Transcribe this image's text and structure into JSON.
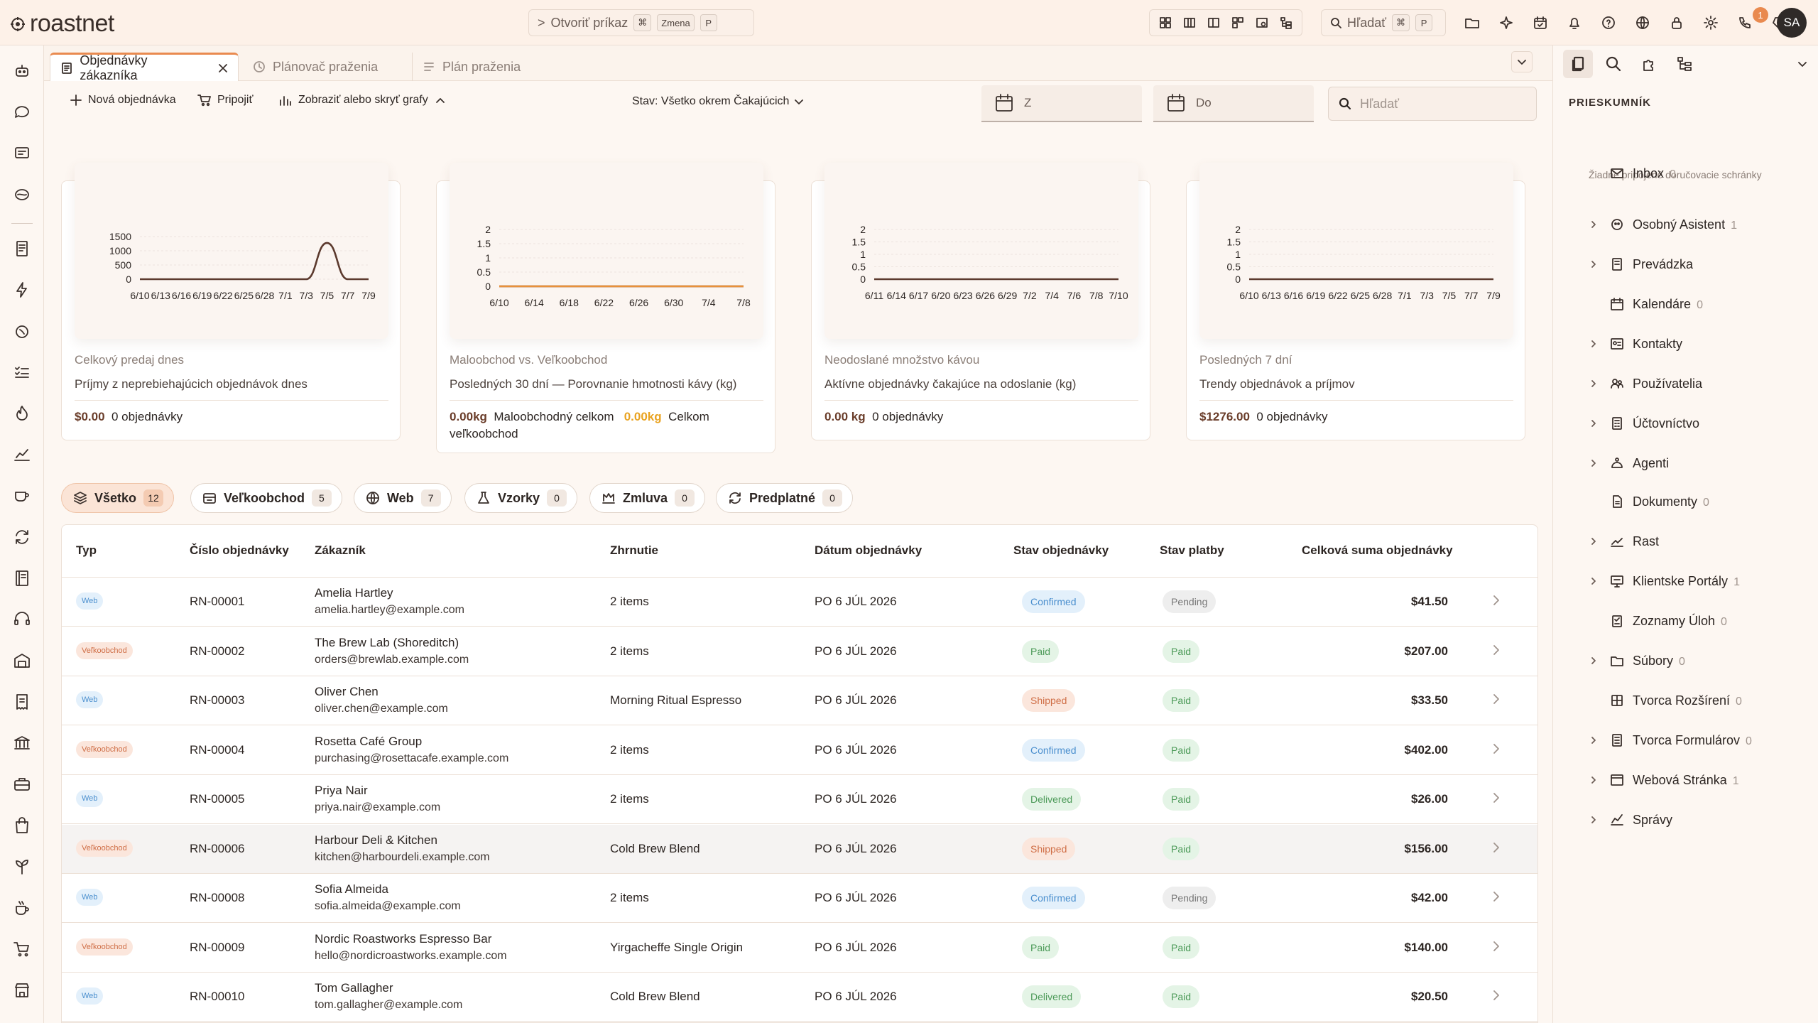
{
  "app": {
    "name": "roastnet"
  },
  "command": {
    "label": "Otvoriť príkaz",
    "k1": "⌘",
    "k2": "Zmena",
    "k3": "P"
  },
  "top_search": {
    "label": "Hľadať",
    "k1": "⌘",
    "k2": "P"
  },
  "notifications": {
    "count": "1"
  },
  "user": {
    "initials": "SA"
  },
  "tabs": [
    {
      "label": "Objednávky zákazníka"
    },
    {
      "label": "Plánovač praženia"
    },
    {
      "label": "Plán praženia"
    }
  ],
  "toolbar": {
    "new_order": "Nová objednávka",
    "connect": "Pripojiť",
    "toggle_charts": "Zobraziť alebo skryť grafy",
    "status_filter": "Stav: Všetko okrem Čakajúcich",
    "date_from": "Z",
    "date_to": "Do",
    "search_placeholder": "Hľadať"
  },
  "cards": [
    {
      "label": "Celkový predaj dnes",
      "desc": "Príjmy z neprebiehajúcich objednávok dnes",
      "stat1": "$0.00",
      "stat1_text": "0 objednávky",
      "stat2": "",
      "stat2_text": ""
    },
    {
      "label": "Maloobchod vs. Veľkoobchod",
      "desc": "Posledných 30 dní — Porovnanie hmotnosti kávy (kg)",
      "stat1": "0.00kg",
      "stat1_text": "Maloobchodný celkom",
      "stat2": "0.00kg",
      "stat2_text": "Celkom veľkoobchod"
    },
    {
      "label": "Neodoslané množstvo kávou",
      "desc": "Aktívne objednávky čakajúce na odoslanie (kg)",
      "stat1": "0.00 kg",
      "stat1_text": "0 objednávky",
      "stat2": "",
      "stat2_text": ""
    },
    {
      "label": "Posledných 7 dní",
      "desc": "Trendy objednávok a príjmov",
      "stat1": "$1276.00",
      "stat1_text": "0 objednávky",
      "stat2": "",
      "stat2_text": ""
    }
  ],
  "chart_data": [
    {
      "type": "line",
      "x": [
        "6/10",
        "6/13",
        "6/16",
        "6/19",
        "6/22",
        "6/25",
        "6/28",
        "7/1",
        "7/3",
        "7/5",
        "7/7",
        "7/9"
      ],
      "yticks": [
        "1500",
        "1000",
        "500",
        "0"
      ],
      "ylim": [
        0,
        1500
      ],
      "spike_label_near": "7/5",
      "series": [
        {
          "values": [
            0,
            0,
            0,
            0,
            0,
            0,
            0,
            0,
            0,
            1276,
            0,
            0
          ],
          "color": "#5c3a2e"
        }
      ]
    },
    {
      "type": "line",
      "x": [
        "6/10",
        "6/14",
        "6/18",
        "6/22",
        "6/26",
        "6/30",
        "7/4",
        "7/8"
      ],
      "yticks": [
        "2",
        "1.5",
        "1",
        "0.5",
        "0"
      ],
      "ylim": [
        0,
        2
      ],
      "series": [
        {
          "values": [
            0,
            0,
            0,
            0,
            0,
            0,
            0,
            0
          ],
          "color": "#5c3a2e"
        },
        {
          "values": [
            0,
            0,
            0,
            0,
            0,
            0,
            0,
            0
          ],
          "color": "#e9913a"
        }
      ]
    },
    {
      "type": "line",
      "x": [
        "6/11",
        "6/14",
        "6/17",
        "6/20",
        "6/23",
        "6/26",
        "6/29",
        "7/2",
        "7/4",
        "7/6",
        "7/8",
        "7/10"
      ],
      "yticks": [
        "2",
        "1.5",
        "1",
        "0.5",
        "0"
      ],
      "ylim": [
        0,
        2
      ],
      "series": [
        {
          "values": [
            0,
            0,
            0,
            0,
            0,
            0,
            0,
            0,
            0,
            0,
            0,
            0
          ],
          "color": "#5c3a2e"
        }
      ]
    },
    {
      "type": "line",
      "x": [
        "6/10",
        "6/13",
        "6/16",
        "6/19",
        "6/22",
        "6/25",
        "6/28",
        "7/1",
        "7/3",
        "7/5",
        "7/7",
        "7/9"
      ],
      "yticks": [
        "2",
        "1.5",
        "1",
        "0.5",
        "0"
      ],
      "ylim": [
        0,
        2
      ],
      "series": [
        {
          "values": [
            0,
            0,
            0,
            0,
            0,
            0,
            0,
            0,
            0,
            0,
            0,
            0
          ],
          "color": "#5c3a2e"
        }
      ]
    }
  ],
  "filters": [
    {
      "label": "Všetko",
      "count": "12"
    },
    {
      "label": "Veľkoobchod",
      "count": "5"
    },
    {
      "label": "Web",
      "count": "7"
    },
    {
      "label": "Vzorky",
      "count": "0"
    },
    {
      "label": "Zmluva",
      "count": "0"
    },
    {
      "label": "Predplatné",
      "count": "0"
    }
  ],
  "table": {
    "headers": [
      "Typ",
      "Číslo objednávky",
      "Zákazník",
      "Zhrnutie",
      "Dátum objednávky",
      "Stav objednávky",
      "Stav platby",
      "Celková suma objednávky"
    ],
    "rows": [
      {
        "type": "Web",
        "id": "RN-00001",
        "name": "Amelia Hartley",
        "email": "amelia.hartley@example.com",
        "summary": "2 items",
        "date": "PO 6 JÚL 2026",
        "status": "Confirmed",
        "payment": "Pending",
        "total": "$41.50"
      },
      {
        "type": "Veľkoobchod",
        "id": "RN-00002",
        "name": "The Brew Lab (Shoreditch)",
        "email": "orders@brewlab.example.com",
        "summary": "2 items",
        "date": "PO 6 JÚL 2026",
        "status": "Paid",
        "payment": "Paid",
        "total": "$207.00"
      },
      {
        "type": "Web",
        "id": "RN-00003",
        "name": "Oliver Chen",
        "email": "oliver.chen@example.com",
        "summary": "Morning Ritual Espresso",
        "date": "PO 6 JÚL 2026",
        "status": "Shipped",
        "payment": "Paid",
        "total": "$33.50"
      },
      {
        "type": "Veľkoobchod",
        "id": "RN-00004",
        "name": "Rosetta Café Group",
        "email": "purchasing@rosettacafe.example.com",
        "summary": "2 items",
        "date": "PO 6 JÚL 2026",
        "status": "Confirmed",
        "payment": "Paid",
        "total": "$402.00"
      },
      {
        "type": "Web",
        "id": "RN-00005",
        "name": "Priya Nair",
        "email": "priya.nair@example.com",
        "summary": "2 items",
        "date": "PO 6 JÚL 2026",
        "status": "Delivered",
        "payment": "Paid",
        "total": "$26.00"
      },
      {
        "type": "Veľkoobchod",
        "id": "RN-00006",
        "name": "Harbour Deli & Kitchen",
        "email": "kitchen@harbourdeli.example.com",
        "summary": "Cold Brew Blend",
        "date": "PO 6 JÚL 2026",
        "status": "Shipped",
        "payment": "Paid",
        "total": "$156.00"
      },
      {
        "type": "Web",
        "id": "RN-00008",
        "name": "Sofia Almeida",
        "email": "sofia.almeida@example.com",
        "summary": "2 items",
        "date": "PO 6 JÚL 2026",
        "status": "Confirmed",
        "payment": "Pending",
        "total": "$42.00"
      },
      {
        "type": "Veľkoobchod",
        "id": "RN-00009",
        "name": "Nordic Roastworks Espresso Bar",
        "email": "hello@nordicroastworks.example.com",
        "summary": "Yirgacheffe Single Origin",
        "date": "PO 6 JÚL 2026",
        "status": "Paid",
        "payment": "Paid",
        "total": "$140.00"
      },
      {
        "type": "Web",
        "id": "RN-00010",
        "name": "Tom Gallagher",
        "email": "tom.gallagher@example.com",
        "summary": "Cold Brew Blend",
        "date": "PO 6 JÚL 2026",
        "status": "Delivered",
        "payment": "Paid",
        "total": "$20.50"
      }
    ]
  },
  "explorer": {
    "title": "PRIESKUMNÍK",
    "no_mailbox": "Žiadne pripojené doručovacie schránky",
    "items": [
      {
        "label": "Inbox",
        "count": "0",
        "icon": "mail-icon",
        "chevron": false
      },
      {
        "label": "Osobný Asistent",
        "count": "1",
        "icon": "assistant-icon",
        "chevron": true
      },
      {
        "label": "Prevádzka",
        "count": "",
        "icon": "operations-icon",
        "chevron": true
      },
      {
        "label": "Kalendáre",
        "count": "0",
        "icon": "calendar-icon",
        "chevron": false
      },
      {
        "label": "Kontakty",
        "count": "",
        "icon": "contacts-icon",
        "chevron": true
      },
      {
        "label": "Používatelia",
        "count": "",
        "icon": "users-icon",
        "chevron": true
      },
      {
        "label": "Účtovníctvo",
        "count": "",
        "icon": "accounting-icon",
        "chevron": true
      },
      {
        "label": "Agenti",
        "count": "",
        "icon": "agents-icon",
        "chevron": true
      },
      {
        "label": "Dokumenty",
        "count": "0",
        "icon": "document-icon",
        "chevron": false
      },
      {
        "label": "Rast",
        "count": "",
        "icon": "growth-icon",
        "chevron": true
      },
      {
        "label": "Klientske Portály",
        "count": "1",
        "icon": "portal-icon",
        "chevron": true
      },
      {
        "label": "Zoznamy Úloh",
        "count": "0",
        "icon": "tasklist-icon",
        "chevron": false
      },
      {
        "label": "Súbory",
        "count": "0",
        "icon": "folder-icon",
        "chevron": true
      },
      {
        "label": "Tvorca Rozšírení",
        "count": "0",
        "icon": "extension-icon",
        "chevron": false
      },
      {
        "label": "Tvorca Formulárov",
        "count": "0",
        "icon": "form-icon",
        "chevron": true
      },
      {
        "label": "Webová Stránka",
        "count": "1",
        "icon": "website-icon",
        "chevron": true
      },
      {
        "label": "Správy",
        "count": "",
        "icon": "reports-icon",
        "chevron": true
      }
    ]
  }
}
